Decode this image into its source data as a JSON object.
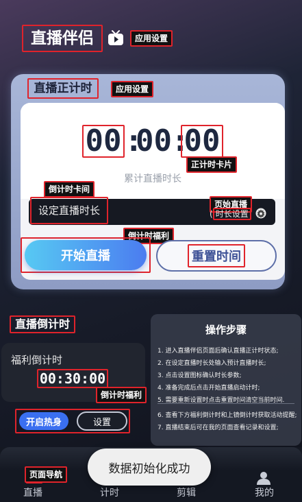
{
  "app": {
    "title": "直播伴侣"
  },
  "timer": {
    "title": "直播正计时",
    "display": [
      "00",
      ":",
      "00",
      ":",
      "00"
    ],
    "subtitle": "累计直播时长",
    "set_duration_label": "设定直播时长",
    "set_duration_right": "时长设置",
    "start_button": "开始直播",
    "reset_button": "重置时间"
  },
  "countdown": {
    "section_title": "直播倒计时",
    "label": "福利倒计时",
    "time": "00:30:00",
    "warmup_button": "开启热身",
    "settings_button": "设置"
  },
  "steps": {
    "title": "操作步骤",
    "items": [
      "1. 进入直播伴侣页面后确认直播正计时状态;",
      "2. 在设定直播时长处输入预计直播时长;",
      "3. 点击设置图标确认时长参数;",
      "4. 准备完成后点击开始直播启动计时;",
      "5. 需要重新设置时点击重置时间清空当前时间.",
      "6. 查看下方福利倒计时和上镜倒计时获取活动提醒;",
      "7. 直播结束后可在我的页面查看记录和设置;"
    ]
  },
  "toast": "数据初始化成功",
  "nav": {
    "items": [
      "直播",
      "计时",
      "剪辑",
      "我的"
    ]
  },
  "annotations": {
    "app_settings_1": "应用设置",
    "app_settings_2": "应用设置",
    "count_up_card": "正计时卡片",
    "countdown_card": "倒计时卡间",
    "page_live": "页始直播",
    "countdown_welfare_1": "倒计时福利",
    "countdown_welfare_2": "倒计时福利",
    "page_nav": "页面导航"
  },
  "colors": {
    "annotation_border": "#e0232b",
    "start_gradient_from": "#57c9f3",
    "start_gradient_to": "#4b7cf0",
    "warmup_button": "#3a6ff0",
    "timer_digits": "#1e2840"
  },
  "icons": {
    "app_icon": "tv-play-icon",
    "gear": "gear-icon",
    "profile": "user-profile-icon"
  }
}
